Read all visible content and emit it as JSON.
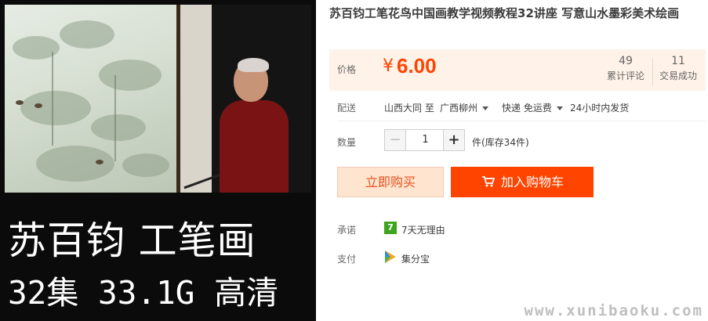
{
  "product_image": {
    "caption_line1": "苏百钧 工笔画",
    "caption_line2": "32集 33.1G 高清"
  },
  "title": "苏百钧工笔花鸟中国画教学视频教程32讲座 写意山水墨彩美术绘画",
  "price": {
    "label": "价格",
    "currency": "¥",
    "value": "6.00",
    "reviews_count": "49",
    "reviews_label": "累计评论",
    "deals_count": "11",
    "deals_label": "交易成功"
  },
  "shipping": {
    "label": "配送",
    "from": "山西大同 至",
    "to": "广西柳州",
    "method": "快递 免运费",
    "time": "24小时内发货"
  },
  "quantity": {
    "label": "数量",
    "minus": "−",
    "value": "1",
    "plus": "+",
    "stock": "件(库存34件)"
  },
  "buttons": {
    "buy_now": "立即购买",
    "add_to_cart": "加入购物车"
  },
  "promise": {
    "label": "承诺",
    "badge": "7",
    "text": "7天无理由"
  },
  "payment": {
    "label": "支付",
    "text": "集分宝"
  },
  "watermark": "www.xunibaoku.com",
  "colors": {
    "accent": "#ff4400",
    "price_bg": "#fff2e8",
    "buy_now_bg": "#ffe4d0",
    "badge_green": "#3ea31d"
  },
  "icons": [
    "cart-icon",
    "seven-day-badge-icon",
    "payment-icon",
    "caret-down-icon"
  ]
}
